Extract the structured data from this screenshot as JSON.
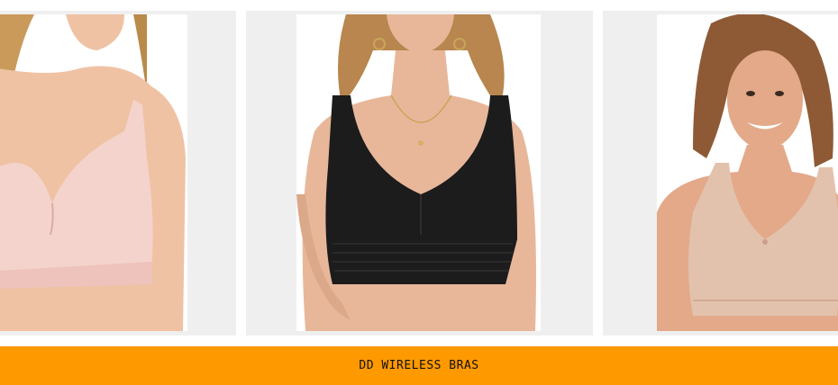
{
  "products": [
    {
      "image_label": "nude pink wireless bra product photo",
      "bra_color": "#f4d3cc"
    },
    {
      "image_label": "black wireless bra product photo",
      "bra_color": "#1c1c1c"
    },
    {
      "image_label": "beige wireless bra product photo",
      "bra_color": "#e3c2ad"
    }
  ],
  "colors": {
    "card_background": "#efefef",
    "banner_background": "#ff9900",
    "banner_text": "#111111",
    "skin": "#e9b89a"
  },
  "banner": {
    "label": "DD WIRELESS BRAS"
  }
}
